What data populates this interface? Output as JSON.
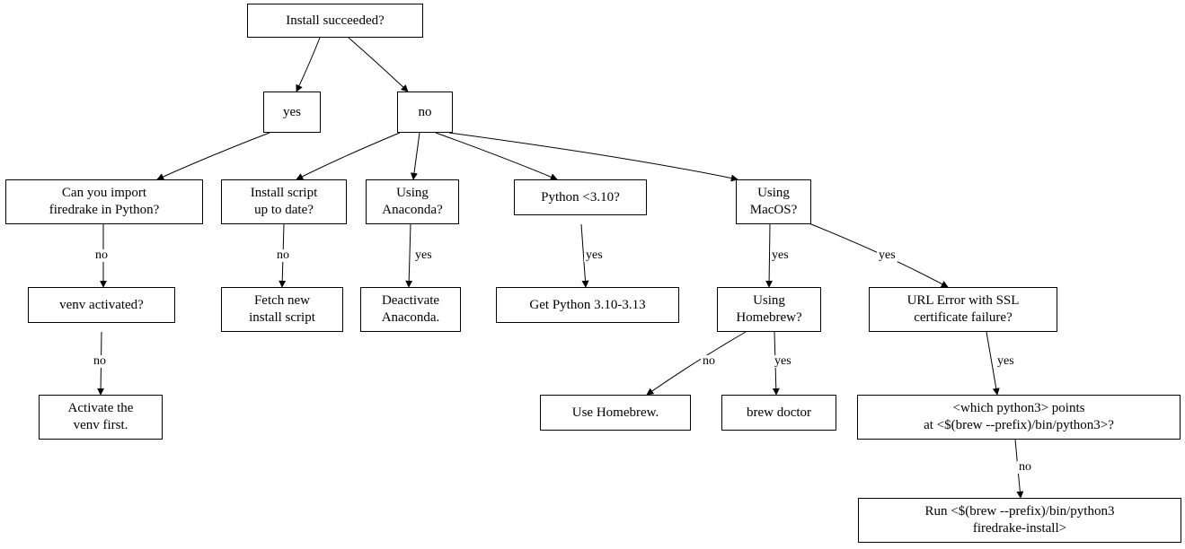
{
  "root": {
    "label": "Install succeeded?"
  },
  "yes_node": {
    "label": "yes"
  },
  "no_node": {
    "label": "no"
  },
  "can_import": {
    "label": "Can you import\nfiredrake in Python?"
  },
  "venv_activated": {
    "label": "venv activated?"
  },
  "activate_venv": {
    "label": "Activate the\nvenv first."
  },
  "install_script": {
    "label": "Install script\nup to date?"
  },
  "fetch_new": {
    "label": "Fetch new\ninstall script"
  },
  "using_anaconda": {
    "label": "Using\nAnaconda?"
  },
  "deactivate_anaconda": {
    "label": "Deactivate\nAnaconda."
  },
  "python_lt310": {
    "label": "Python <3.10?"
  },
  "get_python": {
    "label": "Get Python 3.10-3.13"
  },
  "using_macos": {
    "label": "Using\nMacOS?"
  },
  "using_homebrew": {
    "label": "Using\nHomebrew?"
  },
  "use_homebrew": {
    "label": "Use Homebrew."
  },
  "brew_doctor": {
    "label": "brew doctor"
  },
  "url_error_ssl": {
    "label": "URL Error with SSL\ncertificate failure?"
  },
  "which_python3": {
    "label": "<which python3> points\nat <$(brew --prefix)/bin/python3>?"
  },
  "run_brew_python": {
    "label": "Run <$(brew --prefix)/bin/python3\nfiredrake-install>"
  },
  "edge_labels": {
    "e_can_import_venv": "no",
    "e_venv_activate": "no",
    "e_install_script_fetch": "no",
    "e_anaconda_deactivate": "yes",
    "e_python_get": "yes",
    "e_macos_homebrew": "yes",
    "e_macos_ssl": "yes",
    "e_homebrew_use": "no",
    "e_homebrew_doctor": "yes",
    "e_ssl_which": "yes",
    "e_which_run": "no"
  }
}
